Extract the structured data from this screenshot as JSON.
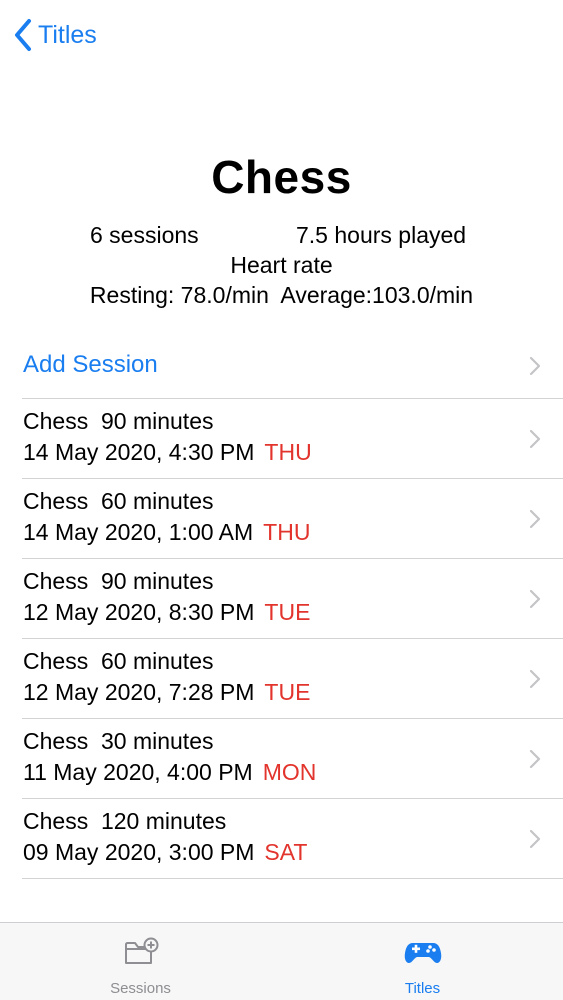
{
  "nav": {
    "back_label": "Titles"
  },
  "game": {
    "title": "Chess",
    "sessions_count": "6 sessions",
    "hours_played": "7.5 hours played",
    "heart_rate_title": "Heart rate",
    "heart_rate_values": "Resting: 78.0/min  Average:103.0/min"
  },
  "list": {
    "add_session_label": "Add Session",
    "sessions": [
      {
        "summary": "Chess  90 minutes",
        "datetime": "14 May 2020, 4:30 PM",
        "day": "THU"
      },
      {
        "summary": "Chess  60 minutes",
        "datetime": "14 May 2020, 1:00 AM",
        "day": "THU"
      },
      {
        "summary": "Chess  90 minutes",
        "datetime": "12 May 2020, 8:30 PM",
        "day": "TUE"
      },
      {
        "summary": "Chess  60 minutes",
        "datetime": "12 May 2020, 7:28 PM",
        "day": "TUE"
      },
      {
        "summary": "Chess  30 minutes",
        "datetime": "11 May 2020, 4:00 PM",
        "day": "MON"
      },
      {
        "summary": "Chess  120 minutes",
        "datetime": "09 May 2020, 3:00 PM",
        "day": "SAT"
      }
    ]
  },
  "tabbar": {
    "tabs": [
      {
        "label": "Sessions",
        "icon": "folder-add-icon",
        "selected": false
      },
      {
        "label": "Titles",
        "icon": "gamecontroller-icon",
        "selected": true
      }
    ]
  },
  "colors": {
    "accent": "#1a7ef0",
    "weekday": "#e2342c",
    "inactive": "#8e8e93"
  }
}
